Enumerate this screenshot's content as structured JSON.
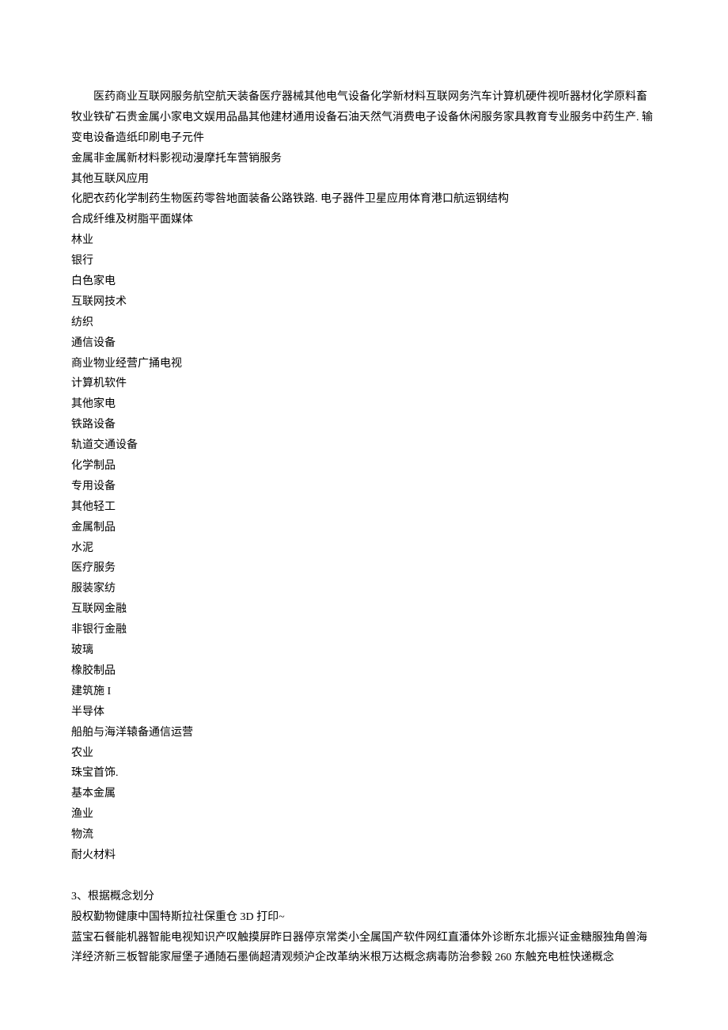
{
  "block1": {
    "line1": "医药商业互联网服务航空航天装备医疗器械其他电气设备化学新材料互联网务汽车计算机硬件视听器材化学原料畜牧业铁矿石贵金属小家电文娱用品晶其他建材通用设备石油天然气消费电子设备休闲服务家具教育专业服务中药生产. 输变电设备造纸印刷电子元件"
  },
  "lines": [
    "金属非金属新材料影视动漫摩托车营销服务",
    "其他互联风应用",
    "化肥衣药化学制药生物医药零咎地面装备公路铁路. 电子器件卫星应用体育港口航运钢结构",
    "合成纤维及树脂平面媒体",
    "林业",
    "银行",
    "白色家电",
    "互联网技术",
    "纺织",
    "通信设备",
    "商业物业经营广捅电视",
    "计算机软件",
    "其他家电",
    "铁路设备",
    "轨道交通设备",
    "化学制品",
    "专用设备",
    "其他轻工",
    "金属制品",
    "水泥",
    "医疗服务",
    "服装家纺",
    "互联网金融",
    "非银行金融",
    "玻璃",
    "橡胶制品",
    "建筑施 I",
    "半导体",
    "船舶与海洋辕备通信运营",
    "农业",
    "珠宝首饰.",
    "基本金属",
    "渔业",
    "物流",
    "耐火材料"
  ],
  "section3": {
    "heading": "3、根据概念划分",
    "line1": "股权勤物健康中国特斯拉社保重仓 3D 打印~",
    "line2": "蓝宝石餐能机器智能电视知识产叹触摸屏昨日器停京常类小全属国产软件网红直潘体外诊断东北振兴证金糖服独角兽海洋经济新三板智能家屉堡子通随石墨倘超清观频沪企改革纳米根万达概念病毒防治参毅 260 东触充电桩快递概念"
  }
}
